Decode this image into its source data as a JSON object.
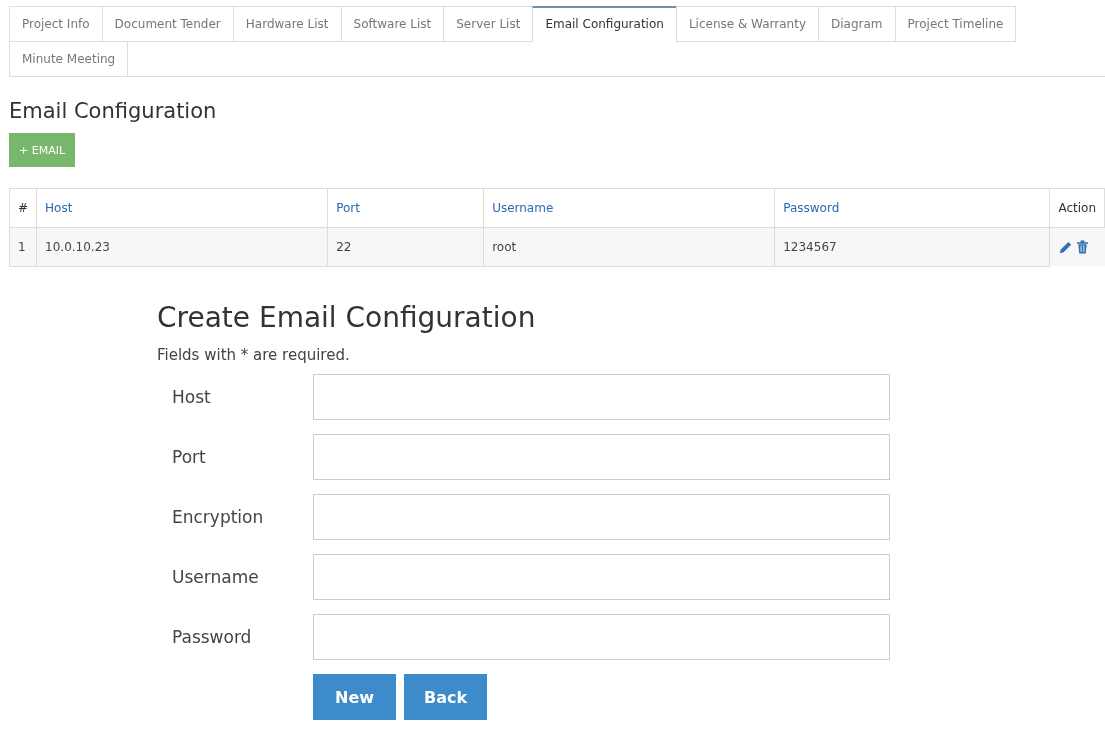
{
  "tabs": [
    {
      "label": "Project Info",
      "selected": false
    },
    {
      "label": "Document Tender",
      "selected": false
    },
    {
      "label": "Hardware List",
      "selected": false
    },
    {
      "label": "Software List",
      "selected": false
    },
    {
      "label": "Server List",
      "selected": false
    },
    {
      "label": "Email Configuration",
      "selected": true
    },
    {
      "label": "License & Warranty",
      "selected": false
    },
    {
      "label": "Diagram",
      "selected": false
    },
    {
      "label": "Project Timeline",
      "selected": false
    },
    {
      "label": "Minute Meeting",
      "selected": false
    }
  ],
  "heading": "Email Configuration",
  "add_button": "+ EMAIL",
  "table": {
    "columns": [
      "#",
      "Host",
      "Port",
      "Username",
      "Password",
      "Action"
    ],
    "rows": [
      {
        "cells": [
          "1",
          "10.0.10.23",
          "22",
          "root",
          "1234567"
        ]
      }
    ]
  },
  "form": {
    "title": "Create Email Configuration",
    "note": "Fields with * are required.",
    "fields": [
      {
        "label": "Host"
      },
      {
        "label": "Port"
      },
      {
        "label": "Encryption"
      },
      {
        "label": "Username"
      },
      {
        "label": "Password"
      }
    ],
    "buttons": [
      "New",
      "Back"
    ]
  }
}
